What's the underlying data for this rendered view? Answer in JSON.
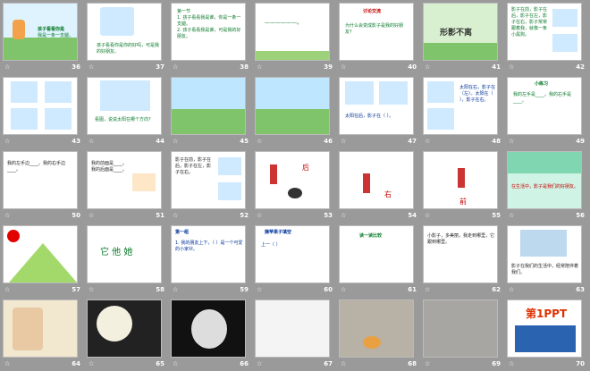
{
  "slides": [
    {
      "num": "36",
      "title": "孩子看看你是",
      "text": "我是一条一支腿。"
    },
    {
      "num": "37",
      "text": "孩子看看你是你的好吗，可是我的好朋友。"
    },
    {
      "num": "38",
      "text": "第一节\n1. 孩子看看我是谁，你是一条一支腿。\n2. 孩子看看我是谁，可是我的好朋友。"
    },
    {
      "num": "39",
      "text": "——————。"
    },
    {
      "num": "40",
      "title": "讨论交流",
      "text": "为什么会变成影子是我的好朋友？"
    },
    {
      "num": "41",
      "title": "形影不离"
    },
    {
      "num": "42",
      "text": "影子在前，影子在后，影子在左，影子在右，影子常常跟着我，就像一条小黑狗。"
    },
    {
      "num": "43"
    },
    {
      "num": "44",
      "text": "看图，说说太阳在哪个方向？"
    },
    {
      "num": "45"
    },
    {
      "num": "46"
    },
    {
      "num": "47",
      "text": "太阳在后，影子在（ ）。"
    },
    {
      "num": "48",
      "text": "太阳在右，影子在（左）。太阳在（ ），影子在右。"
    },
    {
      "num": "49",
      "title": "小练习",
      "text": "我的左手是____。我的右手是____。"
    },
    {
      "num": "50",
      "text": "我的左手边____。我的右手边____。"
    },
    {
      "num": "51",
      "text": "我的前面是____。我的后面是____。"
    },
    {
      "num": "52",
      "text": "影子在前，影子在后，影子在左，影子在右。"
    },
    {
      "num": "53",
      "text": "后"
    },
    {
      "num": "54",
      "text": "右"
    },
    {
      "num": "55",
      "text": "前"
    },
    {
      "num": "56",
      "text": "在生活中，影子是我们的好朋友。"
    },
    {
      "num": "57"
    },
    {
      "num": "58",
      "text": "它 他 她"
    },
    {
      "num": "59",
      "title": "第一组",
      "text": "1. 我的朋友上下，（ ）是一个可爱的小家伙。"
    },
    {
      "num": "60",
      "title": "摘苹果子填空",
      "text": "上一（ ）"
    },
    {
      "num": "61",
      "title": "读一读比较"
    },
    {
      "num": "62",
      "text": "小影子，多美丽，我走到哪里，它跟到哪里。"
    },
    {
      "num": "63",
      "text": "影子在我们的生活中，经常陪伴着我们。"
    },
    {
      "num": "64"
    },
    {
      "num": "65"
    },
    {
      "num": "66"
    },
    {
      "num": "67"
    },
    {
      "num": "68"
    },
    {
      "num": "69"
    },
    {
      "num": "70",
      "title": "第1PPT"
    }
  ],
  "colors": {
    "background": "#9a9a9a",
    "thumb_bg": "#ffffff",
    "caption": "#ffffff",
    "accent": "#cc0000",
    "green": "#0a7a2a"
  }
}
